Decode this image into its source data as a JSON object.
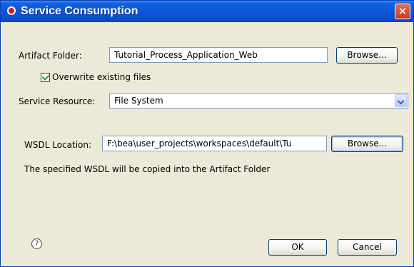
{
  "window": {
    "title": "Service Consumption",
    "close_glyph": "✕"
  },
  "artifact": {
    "label": "Artifact Folder:",
    "value": "Tutorial_Process_Application_Web",
    "browse_label": "Browse..."
  },
  "overwrite": {
    "label": "Overwrite existing files",
    "checked": true
  },
  "service_resource": {
    "label": "Service Resource:",
    "selected": "File System"
  },
  "wsdl": {
    "label": "WSDL Location:",
    "value": "F:\\bea\\user_projects\\workspaces\\default\\Tu",
    "browse_label": "Browse...",
    "note": "The specified WSDL will be copied into the Artifact Folder"
  },
  "help": {
    "glyph": "?"
  },
  "buttons": {
    "ok": "OK",
    "cancel": "Cancel"
  },
  "icons": {
    "app": "oracle-icon",
    "help": "help-icon",
    "close": "close-icon",
    "dropdown": "chevron-down-icon"
  },
  "colors": {
    "titlebar": "#0a4ecf",
    "dialog_background": "#ece9d8",
    "field_border": "#7f9db9"
  }
}
